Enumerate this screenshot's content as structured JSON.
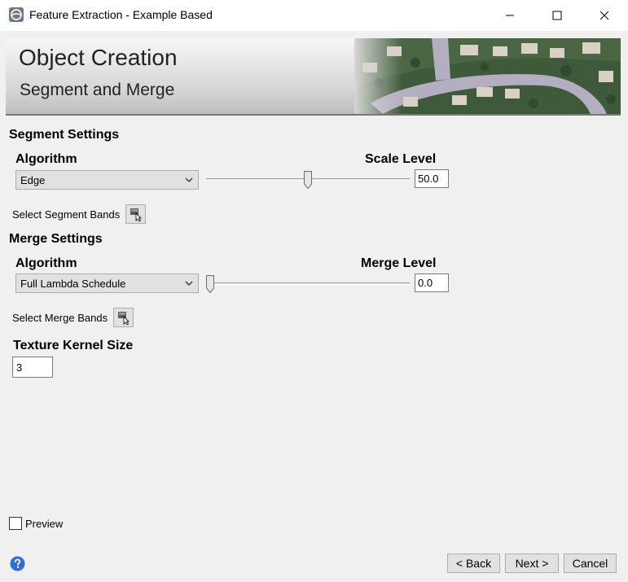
{
  "window": {
    "title": "Feature Extraction - Example Based",
    "icons": {
      "app": "app-logo-icon",
      "minimize": "minimize-icon",
      "maximize": "maximize-icon",
      "close": "close-icon"
    }
  },
  "banner": {
    "title": "Object Creation",
    "subtitle": "Segment and Merge"
  },
  "segment": {
    "section_title": "Segment Settings",
    "algorithm_label": "Algorithm",
    "algorithm_value": "Edge",
    "level_label": "Scale Level",
    "level_value": "50.0",
    "level_fraction": 0.5,
    "bands_label": "Select Segment Bands"
  },
  "merge": {
    "section_title": "Merge Settings",
    "algorithm_label": "Algorithm",
    "algorithm_value": "Full Lambda Schedule",
    "level_label": "Merge Level",
    "level_value": "0.0",
    "level_fraction": 0.0,
    "bands_label": "Select Merge Bands"
  },
  "texture": {
    "label": "Texture Kernel Size",
    "value": "3"
  },
  "preview": {
    "label": "Preview",
    "checked": false
  },
  "footer": {
    "back_label": "< Back",
    "next_label": "Next >",
    "cancel_label": "Cancel"
  }
}
